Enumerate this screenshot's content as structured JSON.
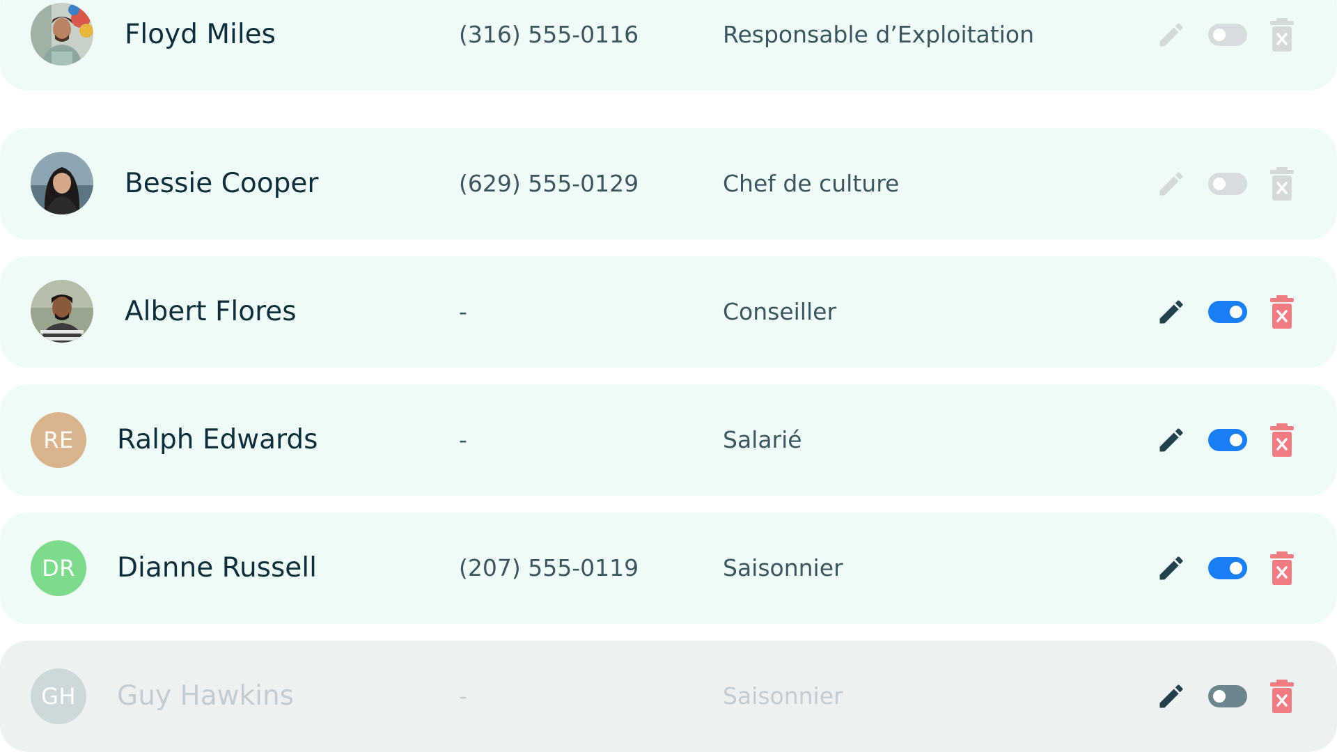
{
  "colors": {
    "row_bg": "#effbf6",
    "row_bg_disabled": "#eef1f2",
    "text_dark": "#0f2d3d",
    "text_muted": "#3c5560",
    "text_disabled": "#c3ccd0",
    "toggle_on": "#1a7ff5",
    "toggle_off_muted": "#d7dcde",
    "toggle_off_dark": "#6f858d",
    "edit_active": "#23414c",
    "edit_inactive": "#d4dad9",
    "delete_active": "#f07b82",
    "delete_inactive": "#d4dad9"
  },
  "members": [
    {
      "name": "Floyd Miles",
      "phone": "(316) 555-0116",
      "role": "Responsable d’Exploitation",
      "avatar": {
        "type": "photo",
        "icon": "person-photo-floyd"
      },
      "toggle_state": "off",
      "actions_enabled": false,
      "row_disabled": false
    },
    {
      "name": "Bessie Cooper",
      "phone": "(629) 555-0129",
      "role": "Chef de culture",
      "avatar": {
        "type": "photo",
        "icon": "person-photo-bessie"
      },
      "toggle_state": "off",
      "actions_enabled": false,
      "row_disabled": false
    },
    {
      "name": "Albert Flores",
      "phone": "-",
      "role": "Conseiller",
      "avatar": {
        "type": "photo",
        "icon": "person-photo-albert"
      },
      "toggle_state": "on",
      "actions_enabled": true,
      "row_disabled": false
    },
    {
      "name": "Ralph Edwards",
      "phone": "-",
      "role": "Salarié",
      "avatar": {
        "type": "initials",
        "initials": "RE",
        "color": "#d9b48c"
      },
      "toggle_state": "on",
      "actions_enabled": true,
      "row_disabled": false
    },
    {
      "name": "Dianne Russell",
      "phone": "(207) 555-0119",
      "role": "Saisonnier",
      "avatar": {
        "type": "initials",
        "initials": "DR",
        "color": "#7ddc8c"
      },
      "toggle_state": "on",
      "actions_enabled": true,
      "row_disabled": false
    },
    {
      "name": "Guy Hawkins",
      "phone": "-",
      "role": "Saisonnier",
      "avatar": {
        "type": "initials",
        "initials": "GH",
        "color": "#cdd8da"
      },
      "toggle_state": "off",
      "actions_enabled": true,
      "row_disabled": true
    }
  ]
}
